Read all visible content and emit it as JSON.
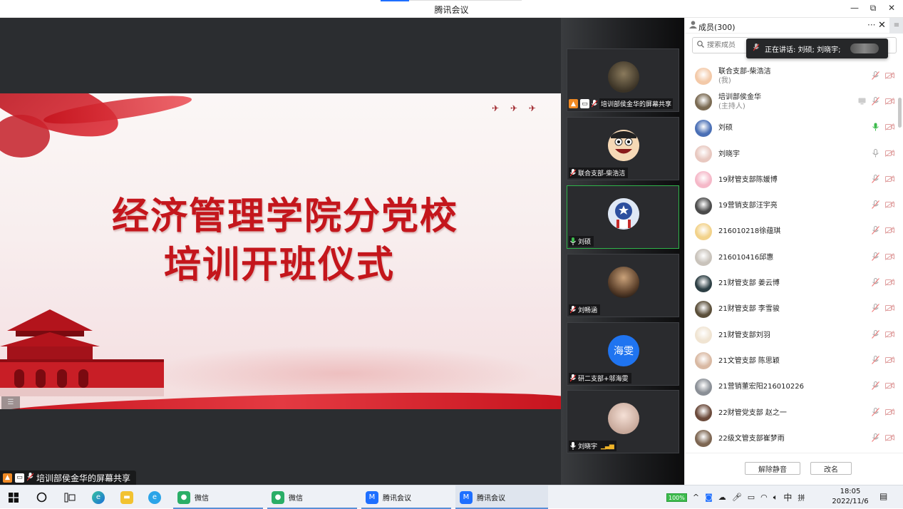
{
  "window": {
    "title": "腾讯会议",
    "controls": [
      "—",
      "⧉",
      "✕"
    ]
  },
  "stage": {
    "slide_line1": "经济管理学院分党校",
    "slide_line2": "培训开班仪式",
    "share_label": "培训部侯金华的屏幕共享",
    "menu_handle": "☰"
  },
  "video_tiles": [
    {
      "name": "培训部侯金华的屏幕共享",
      "avatar": "photo-dark",
      "active": false
    },
    {
      "name": "联合支部-柴浩洁",
      "avatar": "cartoon-face",
      "active": false
    },
    {
      "name": "刘硕",
      "avatar": "captain-america",
      "active": true
    },
    {
      "name": "刘畅涵",
      "avatar": "photo-child",
      "active": false
    },
    {
      "name": "研二支部+邬海雯",
      "avatar": "海雯",
      "active": false
    },
    {
      "name": "刘晓宇",
      "avatar": "photo-woman",
      "active": false
    }
  ],
  "members_panel": {
    "title": "成员(300)",
    "more_label": "···",
    "close_label": "✕",
    "menu_label": "≡",
    "search_placeholder": "搜索成员",
    "speaking_toast": "正在讲话: 刘硕; 刘晓宇;",
    "members": [
      {
        "name": "联合支部-柴浩洁",
        "sub": "(我)",
        "mic": "muted",
        "color": "#f3c9a8"
      },
      {
        "name": "培训部侯金华",
        "sub": "(主持人)",
        "mic": "muted",
        "screen": true,
        "color": "#7a6a52"
      },
      {
        "name": "刘硕",
        "sub": "",
        "mic": "on-green",
        "color": "#4a6fb5"
      },
      {
        "name": "刘晓宇",
        "sub": "",
        "mic": "on-gray",
        "color": "#e8c8c0"
      },
      {
        "name": "19财管支部陈媛博",
        "sub": "",
        "mic": "muted",
        "color": "#f5b8c8"
      },
      {
        "name": "19营销支部汪宇亮",
        "sub": "",
        "mic": "muted",
        "color": "#4b4b4b"
      },
      {
        "name": "216010218徐蕴琪",
        "sub": "",
        "mic": "muted",
        "color": "#f2d28a"
      },
      {
        "name": "216010416邱惠",
        "sub": "",
        "mic": "muted",
        "color": "#c9c3bb"
      },
      {
        "name": "21财管支部 姜云博",
        "sub": "",
        "mic": "muted",
        "color": "#2d3f44"
      },
      {
        "name": "21财管支部 李雪骏",
        "sub": "",
        "mic": "muted",
        "color": "#5b4f3a"
      },
      {
        "name": "21财管支部刘羽",
        "sub": "",
        "mic": "muted",
        "color": "#f0e4d2"
      },
      {
        "name": "21文管支部 陈思颖",
        "sub": "",
        "mic": "muted",
        "color": "#d9b9a3"
      },
      {
        "name": "21营销董宏阳216010226",
        "sub": "",
        "mic": "muted",
        "color": "#8a8f96"
      },
      {
        "name": "22财管党支部 赵之一",
        "sub": "",
        "mic": "muted",
        "color": "#6b4a3b"
      },
      {
        "name": "22级文管支部崔梦雨",
        "sub": "",
        "mic": "muted",
        "color": "#7d6652"
      }
    ],
    "unmute_all_label": "解除静音",
    "rename_label": "改名"
  },
  "taskbar": {
    "apps": [
      {
        "label": "微信",
        "icon": "wechat-icon",
        "color": "#2aae67"
      },
      {
        "label": "微信",
        "icon": "wechat-icon",
        "color": "#2aae67"
      },
      {
        "label": "腾讯会议",
        "icon": "tencent-meeting-icon",
        "color": "#1e6fff"
      },
      {
        "label": "腾讯会议",
        "icon": "tencent-meeting-icon",
        "color": "#1e6fff"
      }
    ],
    "battery": "100%",
    "ime": "中",
    "ime2": "拼",
    "time": "18:05",
    "date": "2022/11/6"
  }
}
